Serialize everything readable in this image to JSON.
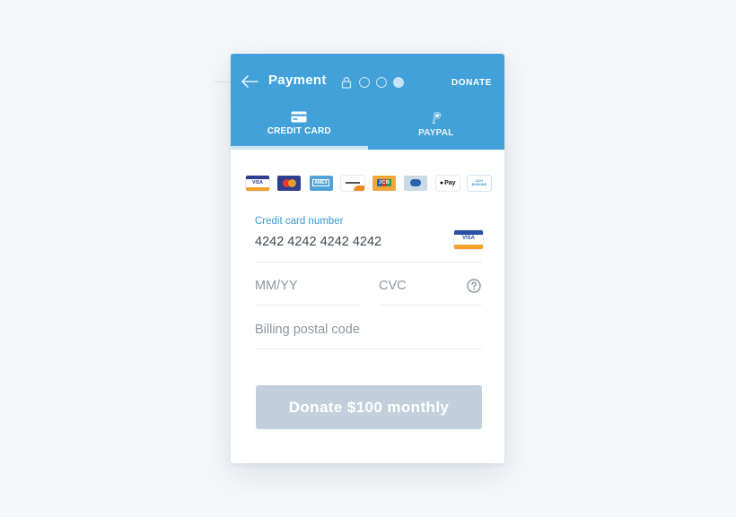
{
  "header": {
    "title": "Payment",
    "donate_link": "DONATE",
    "steps_total": 3,
    "step_current": 3
  },
  "tabs": [
    {
      "label": "CREDIT CARD",
      "icon": "credit-card-icon",
      "active": true
    },
    {
      "label": "PAYPAL",
      "icon": "paypal-icon",
      "active": false
    }
  ],
  "card_logos": [
    {
      "name": "visa-logo",
      "text": "VISA"
    },
    {
      "name": "mastercard-logo",
      "text": ""
    },
    {
      "name": "amex-logo",
      "text": "AMEX"
    },
    {
      "name": "discover-logo",
      "text": ""
    },
    {
      "name": "jcb-logo",
      "text": "JCB"
    },
    {
      "name": "diners-logo",
      "text": ""
    },
    {
      "name": "apple-pay-logo",
      "text": "Pay"
    },
    {
      "name": "ach-banking-logo",
      "text": "ACH BANKING"
    }
  ],
  "form": {
    "card_number_label": "Credit card number",
    "card_number_value": "4242 4242 4242 4242",
    "card_brand": "VISA",
    "expiry_placeholder": "MM/YY",
    "cvc_placeholder": "CVC",
    "postal_placeholder": "Billing postal code"
  },
  "submit_label": "Donate $100 monthly",
  "colors": {
    "header": "#42a1d9",
    "accent_label": "#3b99d1",
    "button_disabled": "#c3d0db",
    "page_bg": "#f6f7f8"
  }
}
